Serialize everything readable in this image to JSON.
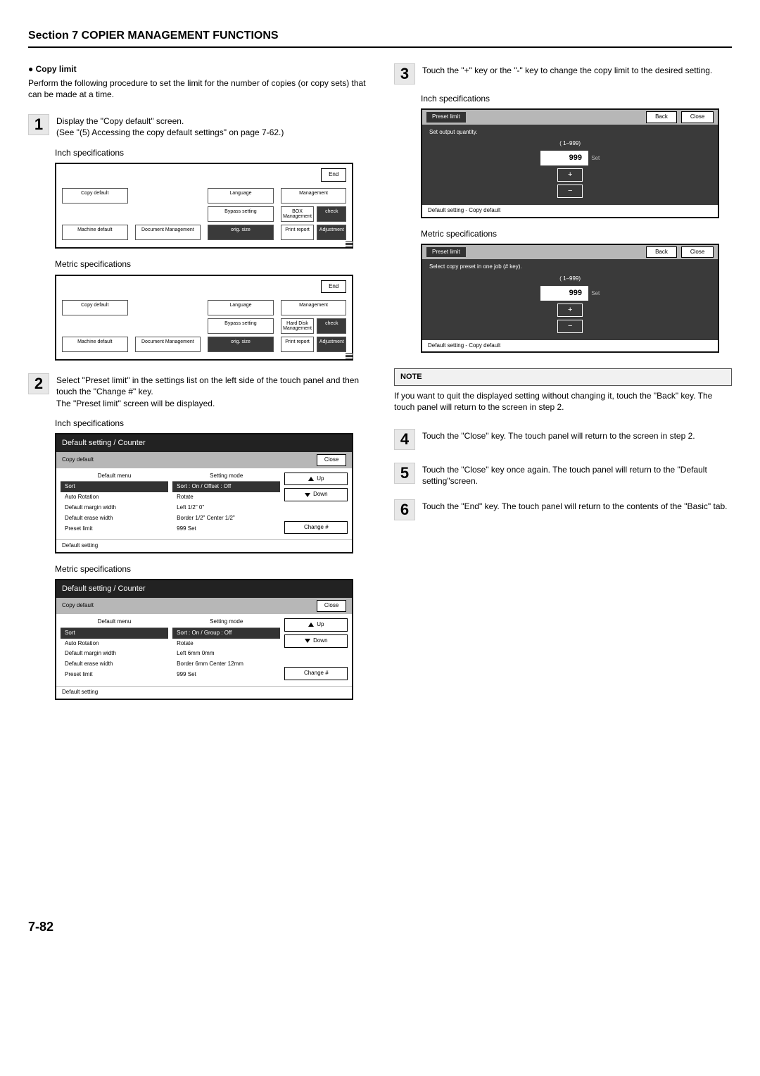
{
  "header": {
    "title": "Section 7  COPIER MANAGEMENT FUNCTIONS"
  },
  "page_number": "7-82",
  "topic": {
    "title": "Copy limit",
    "intro": "Perform the following procedure to set the limit for the number of copies (or copy sets) that can be made at a time."
  },
  "labels": {
    "inch": "Inch specifications",
    "metric": "Metric specifications",
    "end": "End",
    "close": "Close",
    "back": "Back",
    "up": "Up",
    "down": "Down",
    "change": "Change #",
    "note": "NOTE"
  },
  "def_panel_inch": {
    "cells": [
      [
        "Copy default",
        "",
        "Language",
        "Management"
      ],
      [
        "",
        "",
        "Bypass setting",
        "BOX Management",
        "check"
      ],
      [
        "Machine default",
        "Document Management",
        "orig. size",
        "Print report",
        "Adjustment"
      ]
    ]
  },
  "def_panel_metric": {
    "cells": [
      [
        "Copy default",
        "",
        "Language",
        "Management"
      ],
      [
        "",
        "",
        "Bypass setting",
        "Hard Disk Management",
        "check"
      ],
      [
        "Machine default",
        "Document Management",
        "orig. size",
        "Print report",
        "Adjustment"
      ]
    ]
  },
  "counter": {
    "title": "Default setting / Counter",
    "sub": "Copy default",
    "footer": "Default setting",
    "menu_head": "Default menu",
    "mode_head": "Setting mode"
  },
  "counter_inch": {
    "menu": [
      "Sort",
      "Auto Rotation",
      "Default margin width",
      "Default erase width",
      "Preset limit"
    ],
    "mode": [
      "Sort : On / Offset : Off",
      "Rotate",
      "Left 1/2\"   0\"",
      "Border 1/2\"   Center 1/2\"",
      "999 Set"
    ]
  },
  "counter_metric": {
    "menu": [
      "Sort",
      "Auto Rotation",
      "Default margin width",
      "Default erase width",
      "Preset limit"
    ],
    "mode": [
      "Sort : On / Group : Off",
      "Rotate",
      "Left 6mm   0mm",
      "Border 6mm  Center 12mm",
      "999 Set"
    ]
  },
  "preset": {
    "title": "Preset limit",
    "range": "( 1–999)",
    "value": "999",
    "unit": "Set",
    "footer": "Default setting - Copy default",
    "prompt_inch": "Set output quantity.",
    "prompt_metric": "Select copy preset in one job (# key)."
  },
  "steps": {
    "s1": {
      "text": "Display the \"Copy default\" screen.",
      "ref": "(See \"(5) Accessing the copy default settings\" on page 7-62.)"
    },
    "s2": {
      "text": "Select \"Preset limit\" in the settings list on the left side of the touch panel and then touch the \"Change #\" key.",
      "text2": "The \"Preset limit\" screen will be displayed."
    },
    "s3": {
      "text": "Touch the \"+\" key or the \"-\" key to change the copy limit to the desired setting."
    },
    "s4": {
      "text": "Touch the \"Close\" key. The touch panel will return to the screen in step 2."
    },
    "s5": {
      "text": "Touch the \"Close\" key once again. The touch panel will return to the \"Default setting\"screen."
    },
    "s6": {
      "text": "Touch the \"End\" key. The touch panel will return to the contents of the \"Basic\" tab."
    }
  },
  "note_text": "If you want to quit the displayed setting without changing it, touch the \"Back\" key. The touch panel will return to the screen in step 2."
}
